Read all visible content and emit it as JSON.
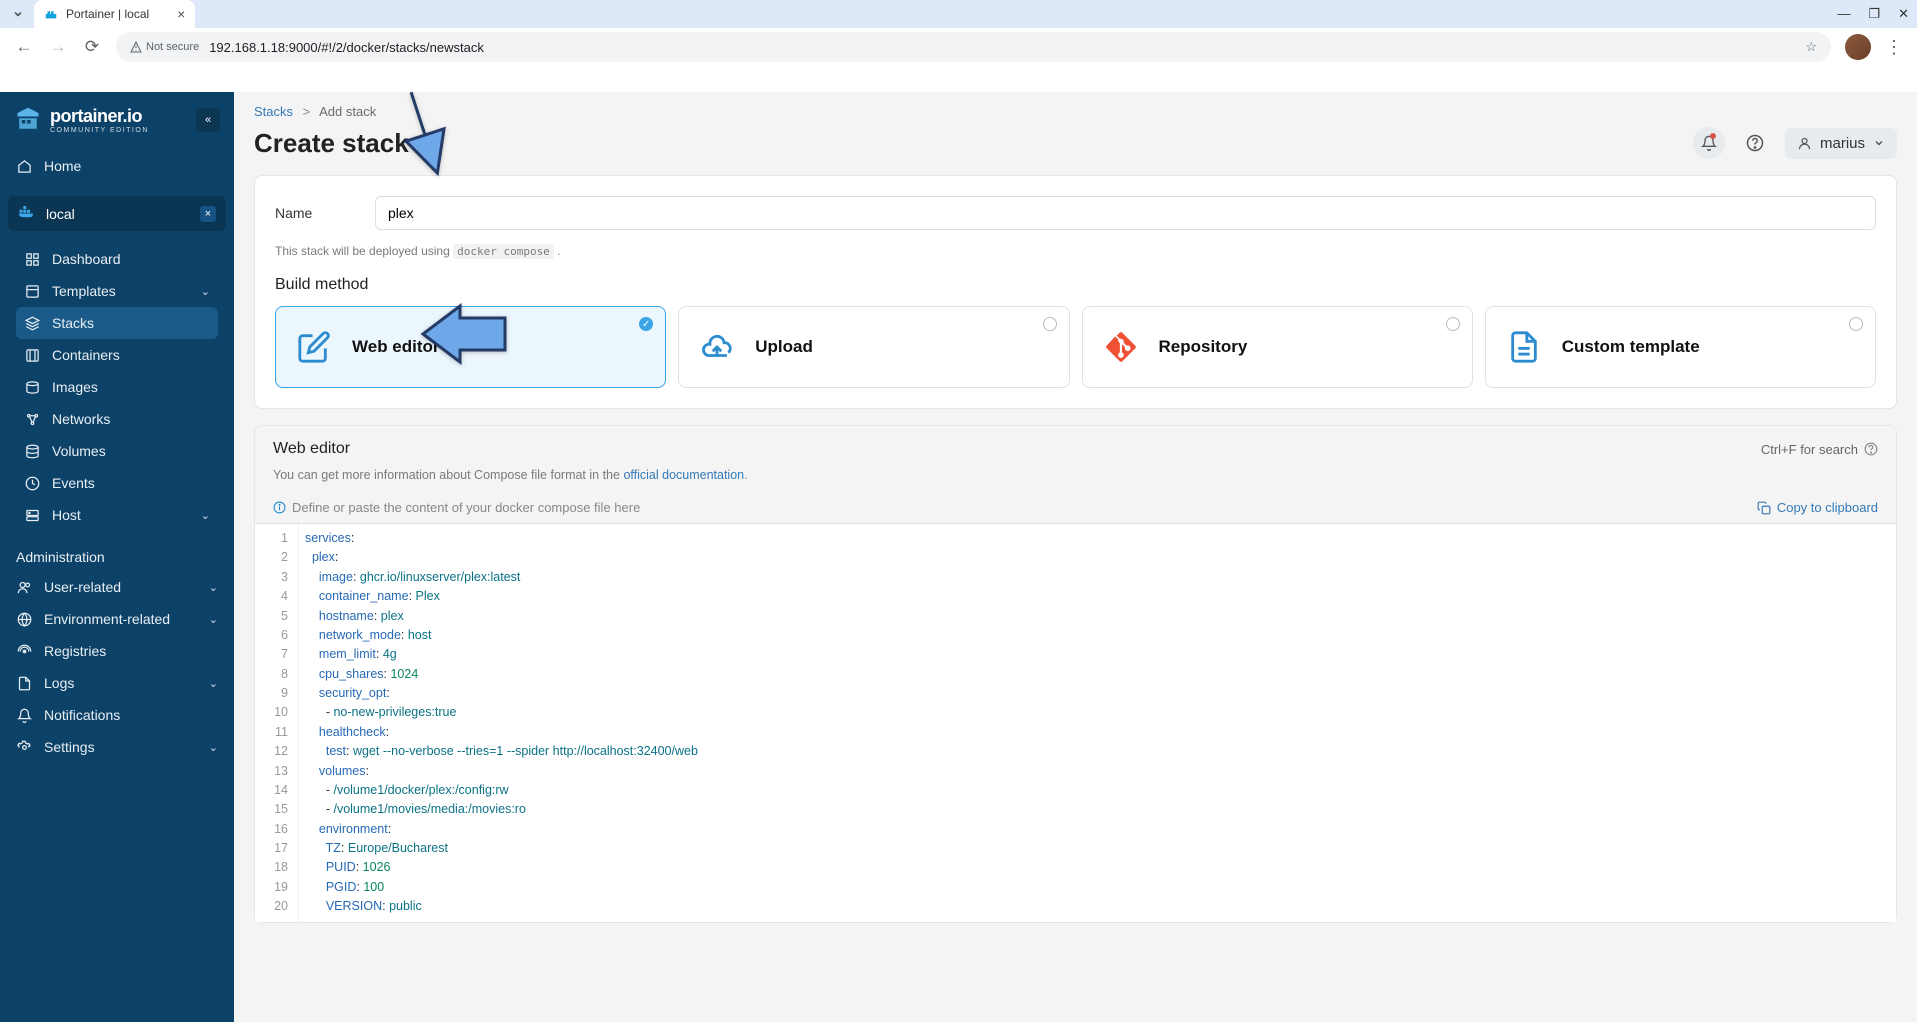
{
  "browser": {
    "tab_title": "Portainer | local",
    "url": "192.168.1.18:9000/#!/2/docker/stacks/newstack",
    "not_secure": "Not secure"
  },
  "sidebar": {
    "brand": "portainer.io",
    "brand_sub": "COMMUNITY EDITION",
    "home": "Home",
    "env_name": "local",
    "items": [
      {
        "label": "Dashboard"
      },
      {
        "label": "Templates"
      },
      {
        "label": "Stacks"
      },
      {
        "label": "Containers"
      },
      {
        "label": "Images"
      },
      {
        "label": "Networks"
      },
      {
        "label": "Volumes"
      },
      {
        "label": "Events"
      },
      {
        "label": "Host"
      }
    ],
    "admin_title": "Administration",
    "admin_items": [
      {
        "label": "User-related"
      },
      {
        "label": "Environment-related"
      },
      {
        "label": "Registries"
      },
      {
        "label": "Logs"
      },
      {
        "label": "Notifications"
      },
      {
        "label": "Settings"
      }
    ]
  },
  "breadcrumbs": {
    "root": "Stacks",
    "current": "Add stack"
  },
  "page_title": "Create stack",
  "user_name": "marius",
  "form": {
    "name_label": "Name",
    "name_value": "plex",
    "deploy_hint_pre": "This stack will be deployed using ",
    "deploy_hint_code": "docker compose",
    "deploy_hint_post": " .",
    "build_method_title": "Build method",
    "methods": {
      "web_editor": "Web editor",
      "upload": "Upload",
      "repository": "Repository",
      "custom_template": "Custom template"
    }
  },
  "editor": {
    "title": "Web editor",
    "shortcut": "Ctrl+F for search",
    "desc_pre": "You can get more information about Compose file format in the ",
    "desc_link": "official documentation",
    "desc_post": ".",
    "tip": "Define or paste the content of your docker compose file here",
    "copy": "Copy to clipboard",
    "code": [
      {
        "n": 1,
        "t": [
          [
            "key",
            "services"
          ],
          [
            "punct",
            ":"
          ]
        ]
      },
      {
        "n": 2,
        "t": [
          [
            "ws",
            "  "
          ],
          [
            "key",
            "plex"
          ],
          [
            "punct",
            ":"
          ]
        ]
      },
      {
        "n": 3,
        "t": [
          [
            "ws",
            "    "
          ],
          [
            "key",
            "image"
          ],
          [
            "punct",
            ": "
          ],
          [
            "str2",
            "ghcr.io/linuxserver/plex:latest"
          ]
        ]
      },
      {
        "n": 4,
        "t": [
          [
            "ws",
            "    "
          ],
          [
            "key",
            "container_name"
          ],
          [
            "punct",
            ": "
          ],
          [
            "str2",
            "Plex"
          ]
        ]
      },
      {
        "n": 5,
        "t": [
          [
            "ws",
            "    "
          ],
          [
            "key",
            "hostname"
          ],
          [
            "punct",
            ": "
          ],
          [
            "str2",
            "plex"
          ]
        ]
      },
      {
        "n": 6,
        "t": [
          [
            "ws",
            "    "
          ],
          [
            "key",
            "network_mode"
          ],
          [
            "punct",
            ": "
          ],
          [
            "str2",
            "host"
          ]
        ]
      },
      {
        "n": 7,
        "t": [
          [
            "ws",
            "    "
          ],
          [
            "key",
            "mem_limit"
          ],
          [
            "punct",
            ": "
          ],
          [
            "str2",
            "4g"
          ]
        ]
      },
      {
        "n": 8,
        "t": [
          [
            "ws",
            "    "
          ],
          [
            "key",
            "cpu_shares"
          ],
          [
            "punct",
            ": "
          ],
          [
            "num",
            "1024"
          ]
        ]
      },
      {
        "n": 9,
        "t": [
          [
            "ws",
            "    "
          ],
          [
            "key",
            "security_opt"
          ],
          [
            "punct",
            ":"
          ]
        ]
      },
      {
        "n": 10,
        "t": [
          [
            "ws",
            "      "
          ],
          [
            "punct",
            "- "
          ],
          [
            "str2",
            "no-new-privileges:true"
          ]
        ]
      },
      {
        "n": 11,
        "t": [
          [
            "ws",
            "    "
          ],
          [
            "key",
            "healthcheck"
          ],
          [
            "punct",
            ":"
          ]
        ]
      },
      {
        "n": 12,
        "t": [
          [
            "ws",
            "      "
          ],
          [
            "key",
            "test"
          ],
          [
            "punct",
            ": "
          ],
          [
            "str2",
            "wget --no-verbose --tries=1 --spider http://localhost:32400/web"
          ]
        ]
      },
      {
        "n": 13,
        "t": [
          [
            "ws",
            "    "
          ],
          [
            "key",
            "volumes"
          ],
          [
            "punct",
            ":"
          ]
        ]
      },
      {
        "n": 14,
        "t": [
          [
            "ws",
            "      "
          ],
          [
            "punct",
            "- "
          ],
          [
            "str2",
            "/volume1/docker/plex:/config:rw"
          ]
        ]
      },
      {
        "n": 15,
        "t": [
          [
            "ws",
            "      "
          ],
          [
            "punct",
            "- "
          ],
          [
            "str2",
            "/volume1/movies/media:/movies:ro"
          ]
        ]
      },
      {
        "n": 16,
        "t": [
          [
            "ws",
            "    "
          ],
          [
            "key",
            "environment"
          ],
          [
            "punct",
            ":"
          ]
        ]
      },
      {
        "n": 17,
        "t": [
          [
            "ws",
            "      "
          ],
          [
            "key",
            "TZ"
          ],
          [
            "punct",
            ": "
          ],
          [
            "str2",
            "Europe/Bucharest"
          ]
        ]
      },
      {
        "n": 18,
        "t": [
          [
            "ws",
            "      "
          ],
          [
            "key",
            "PUID"
          ],
          [
            "punct",
            ": "
          ],
          [
            "num",
            "1026"
          ]
        ]
      },
      {
        "n": 19,
        "t": [
          [
            "ws",
            "      "
          ],
          [
            "key",
            "PGID"
          ],
          [
            "punct",
            ": "
          ],
          [
            "num",
            "100"
          ]
        ]
      },
      {
        "n": 20,
        "t": [
          [
            "ws",
            "      "
          ],
          [
            "key",
            "VERSION"
          ],
          [
            "punct",
            ": "
          ],
          [
            "str2",
            "public"
          ]
        ]
      }
    ]
  }
}
